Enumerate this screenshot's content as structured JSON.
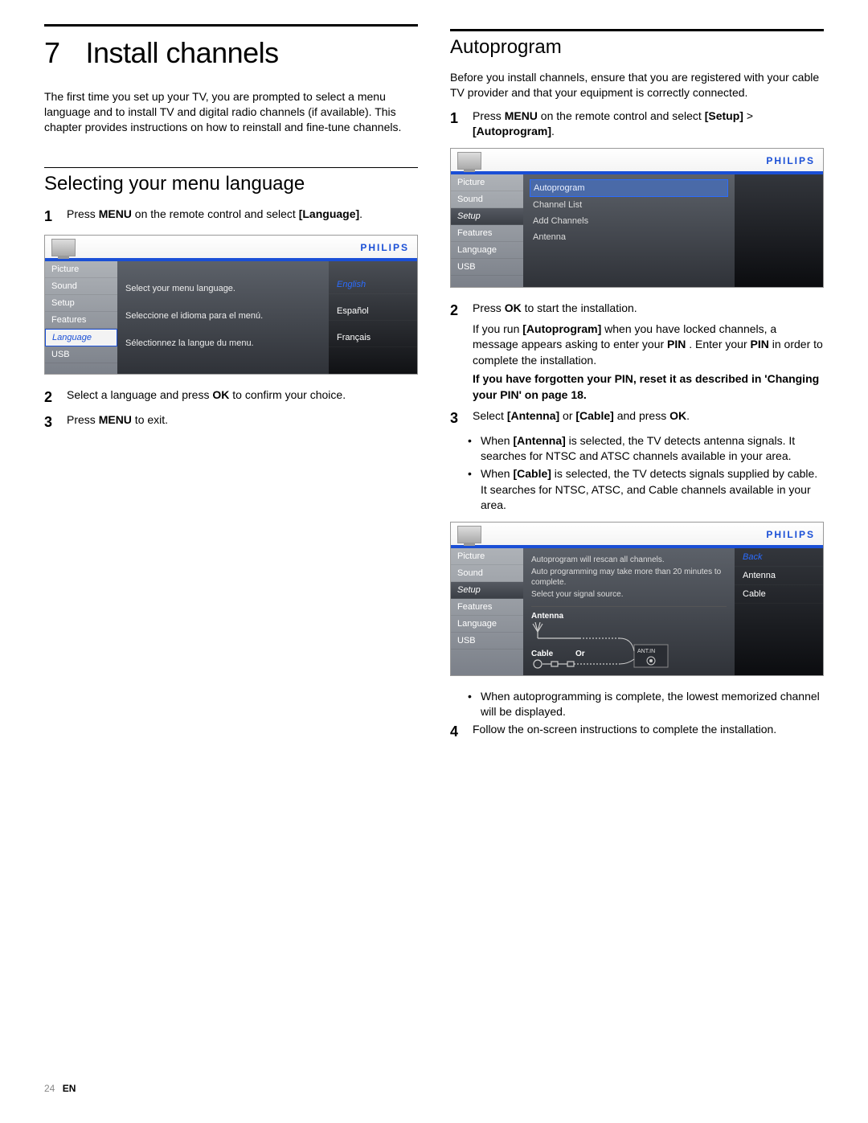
{
  "footer": {
    "pageNum": "24",
    "lang": "EN"
  },
  "colL": {
    "chapterNum": "7",
    "chapterTitle": "Install channels",
    "intro": "The first time you set up your TV, you are prompted to select a menu language and to install TV and digital radio channels (if available). This chapter provides instructions on how to reinstall and fine-tune channels.",
    "h2": "Selecting your menu language",
    "step1_a": "Press ",
    "step1_b": "MENU",
    "step1_c": " on the remote control and select ",
    "step1_d": "[Language]",
    "step1_e": ".",
    "step2_a": "Select a language and press ",
    "step2_b": "OK",
    "step2_c": " to confirm your choice.",
    "step3_a": "Press ",
    "step3_b": "MENU",
    "step3_c": " to exit."
  },
  "tv1": {
    "brand": "PHILIPS",
    "side": [
      "Picture",
      "Sound",
      "Setup",
      "Features",
      "Language",
      "USB"
    ],
    "sideSelIndex": 4,
    "center": [
      "Select your menu language.",
      "Seleccione el idioma para el menú.",
      "Sélectionnez la langue du menu."
    ],
    "right": [
      "English",
      "Español",
      "Français"
    ],
    "rightSelIndex": 0
  },
  "colR": {
    "h2": "Autoprogram",
    "intro": "Before you install channels, ensure that you are registered with your cable TV provider and that your equipment is correctly connected.",
    "step1_a": "Press ",
    "step1_b": "MENU",
    "step1_c": " on the remote control and select ",
    "step1_d": "[Setup]",
    "step1_e": " > ",
    "step1_f": "[Autoprogram]",
    "step1_g": ".",
    "step2_a": "Press ",
    "step2_b": "OK",
    "step2_c": " to start the installation.",
    "note2a_a": "If you run ",
    "note2a_b": "[Autoprogram]",
    "note2a_c": " when you have locked channels, a message appears asking to enter your ",
    "note2a_d": "PIN",
    "note2a_e": " . Enter your ",
    "note2a_f": "PIN",
    "note2a_g": " in order to complete the installation.",
    "note2b": "If you have forgotten your PIN, reset it as described in 'Changing your PIN' on page 18.",
    "step3_a": "Select ",
    "step3_b": "[Antenna]",
    "step3_c": " or ",
    "step3_d": "[Cable]",
    "step3_e": " and press ",
    "step3_f": "OK",
    "step3_g": ".",
    "b3a_a": "When ",
    "b3a_b": "[Antenna]",
    "b3a_c": " is selected, the TV detects antenna signals. It searches for NTSC and ATSC channels available in your area.",
    "b3b_a": "When ",
    "b3b_b": "[Cable]",
    "b3b_c": " is selected, the TV detects signals supplied by cable. It searches for NTSC, ATSC, and Cable channels available in your area.",
    "b3c": "When autoprogramming is complete, the lowest memorized channel will be displayed.",
    "step4": "Follow the on-screen instructions to complete the installation."
  },
  "tv2": {
    "brand": "PHILIPS",
    "side": [
      "Picture",
      "Sound",
      "Setup",
      "Features",
      "Language",
      "USB"
    ],
    "sideHlIndex": 2,
    "sub": [
      "Autoprogram",
      "Channel List",
      "Add Channels",
      "Antenna"
    ],
    "subSelIndex": 0
  },
  "tv3": {
    "brand": "PHILIPS",
    "side": [
      "Picture",
      "Sound",
      "Setup",
      "Features",
      "Language",
      "USB"
    ],
    "sideHlIndex": 2,
    "msg1": "Autoprogram will rescan all channels.",
    "msg2": "Auto programming  may take more than 20 minutes to complete.",
    "msg3": "Select your signal source.",
    "antLabel": "Antenna",
    "cableLabel": "Cable",
    "orLabel": "Or",
    "antin": "ANT.IN",
    "right": [
      "Back",
      "Antenna",
      "Cable"
    ],
    "rightSelIndex": 0
  }
}
